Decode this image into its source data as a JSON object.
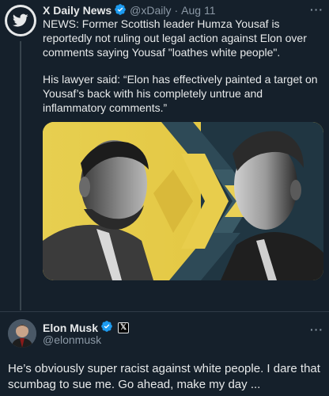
{
  "post1": {
    "author_name": "X Daily News",
    "handle": "@xDaily",
    "separator": "·",
    "date": "Aug 11",
    "more": "···",
    "paragraph1": "NEWS: Former Scottish leader Humza Yousaf is reportedly not ruling out legal action against Elon over comments saying Yousaf \"loathes white people\".",
    "paragraph2": "His lawyer said: “Elon has effectively painted a target on Yousaf’s back with his completely untrue and inflammatory comments.”"
  },
  "post2": {
    "author_name": "Elon Musk",
    "handle": "@elonmusk",
    "more": "···",
    "x_badge": "𝕏",
    "text": "He’s obviously super racist against white people. I dare that scumbag to sue me. Go ahead, make my day ..."
  },
  "colors": {
    "background": "#15202b",
    "text": "#e7e9ea",
    "muted": "#8b98a5",
    "verified": "#1d9bf0",
    "divider": "#2f3b47"
  },
  "icons": {
    "avatar1": "twitter-bird-icon",
    "verified": "verified-badge-icon"
  }
}
